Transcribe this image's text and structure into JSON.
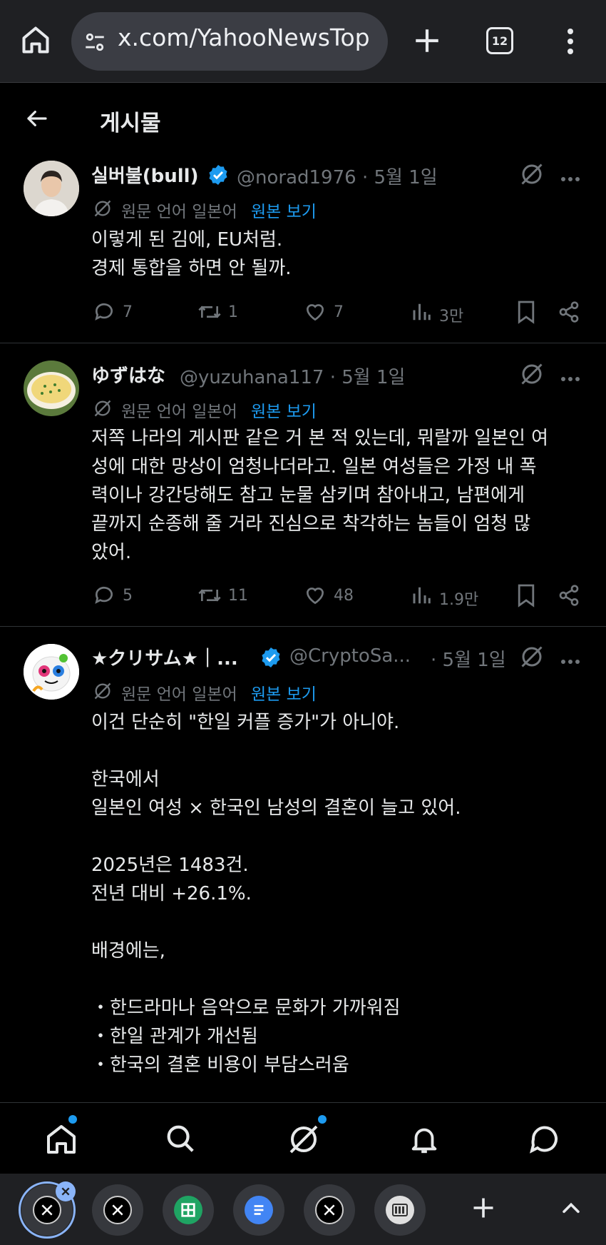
{
  "browser": {
    "url": "x.com/YahooNewsTop",
    "tab_count": "12"
  },
  "header": {
    "title": "게시물"
  },
  "posts": [
    {
      "name": "실버불(bull)",
      "verified": true,
      "handle": "@norad1976 · 5월 1일",
      "translation_label": "원문 언어 일본어",
      "translation_link": "원본 보기",
      "lines": [
        "이렇게 된 김에, EU처럼.",
        "경제 통합을 하면 안 될까."
      ],
      "replies": "7",
      "reposts": "1",
      "likes": "7",
      "views": "3만"
    },
    {
      "name": "ゆずはな",
      "verified": false,
      "handle": "@yuzuhana117 · 5월 1일",
      "translation_label": "원문 언어 일본어",
      "translation_link": "원본 보기",
      "lines": [
        "저쪽 나라의 게시판 같은 거 본 적 있는데, 뭐랄까 일본인 여",
        "성에 대한 망상이 엄청나더라고. 일본 여성들은 가정 내 폭",
        "력이나 강간당해도 참고 눈물 삼키며 참아내고, 남편에게",
        "끝까지 순종해 줄 거라 진심으로 착각하는 놈들이 엄청 많",
        "았어."
      ],
      "replies": "5",
      "reposts": "11",
      "likes": "48",
      "views": "1.9만"
    },
    {
      "name": "★クリサム★｜...",
      "verified": true,
      "handle": "@CryptoSa...",
      "date": "· 5월 1일",
      "translation_label": "원문 언어 일본어",
      "translation_link": "원본 보기",
      "lines": [
        "이건 단순히 \"한일 커플 증가\"가 아니야.",
        "",
        "한국에서",
        "일본인 여성 × 한국인 남성의 결혼이 늘고 있어.",
        "",
        "2025년은 1483건.",
        "전년 대비 +26.1%.",
        "",
        "배경에는,",
        "",
        "・한드라마나 음악으로 문화가 가까워짐",
        "・한일 관계가 개선됨",
        "・한국의 결혼 비용이 부담스러움"
      ]
    }
  ],
  "icons": {
    "home": "home-icon",
    "search": "search-icon",
    "grok": "grok-icon",
    "notifications": "bell-icon",
    "messages": "chat-icon"
  },
  "colors": {
    "accent": "#1d9bf0",
    "muted": "#71767b",
    "background": "#000000"
  }
}
